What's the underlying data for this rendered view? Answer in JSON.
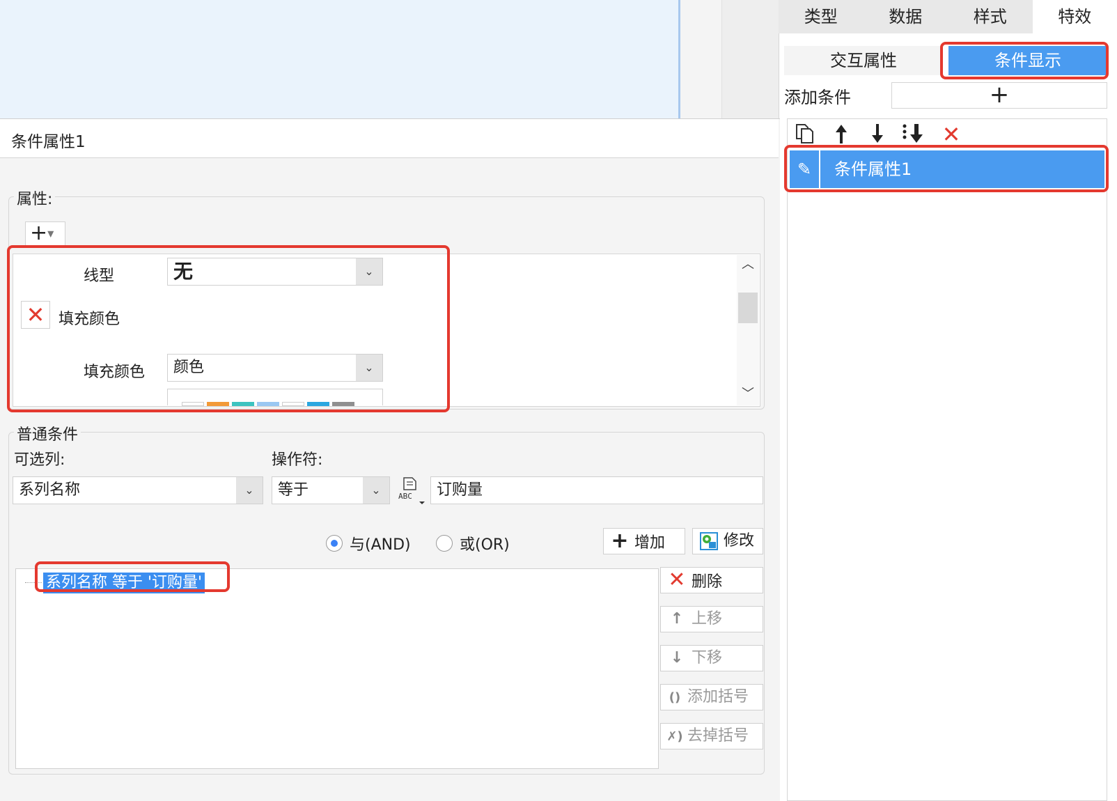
{
  "top_tabs": [
    "类型",
    "数据",
    "样式",
    "特效"
  ],
  "sub_tabs": {
    "interaction": "交互属性",
    "condition": "条件显示"
  },
  "add_condition": {
    "label": "添加条件",
    "button": "+"
  },
  "condition_list": {
    "items": [
      {
        "label": "条件属性1"
      }
    ]
  },
  "dialog": {
    "title": "条件属性1",
    "properties": {
      "group_label": "属性:",
      "add_button": "+",
      "line_type_label": "线型",
      "line_type_value": "无",
      "fill_color_toggle_label": "填充颜色",
      "fill_color_label": "填充颜色",
      "fill_color_value": "颜色",
      "swatch_colors": [
        "#ffffff",
        "#f29a38",
        "#3cc3c0",
        "#9ac8f2",
        "#ffffff",
        "#2aa7e0",
        "#8f8f8f"
      ]
    },
    "condition": {
      "group_label": "普通条件",
      "column_label": "可选列:",
      "column_value": "系列名称",
      "operator_label": "操作符:",
      "operator_value": "等于",
      "value": "订购量",
      "and_label": "与(AND)",
      "or_label": "或(OR)",
      "add_label": "增加",
      "modify_label": "修改",
      "delete_label": "删除",
      "move_up_label": "上移",
      "move_down_label": "下移",
      "add_bracket_label": "添加括号",
      "remove_bracket_label": "去掉括号",
      "expression": "系列名称 等于 '订购量'"
    }
  },
  "colors": {
    "accent": "#4a9bf0",
    "highlight": "#e4392f"
  }
}
